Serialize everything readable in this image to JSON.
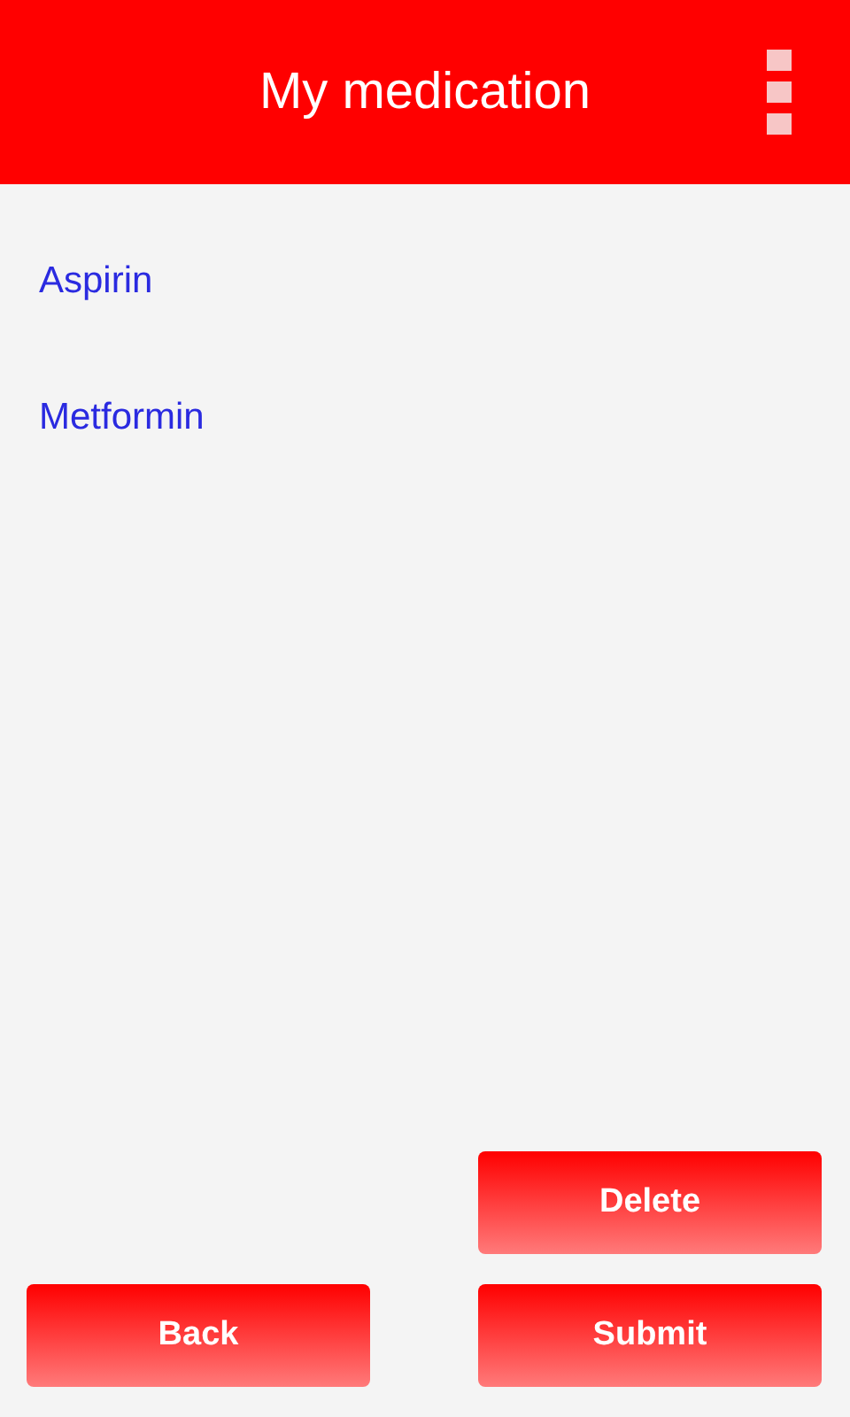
{
  "header": {
    "title": "My medication"
  },
  "medications": [
    {
      "name": "Aspirin"
    },
    {
      "name": "Metformin"
    }
  ],
  "buttons": {
    "delete": "Delete",
    "back": "Back",
    "submit": "Submit"
  }
}
